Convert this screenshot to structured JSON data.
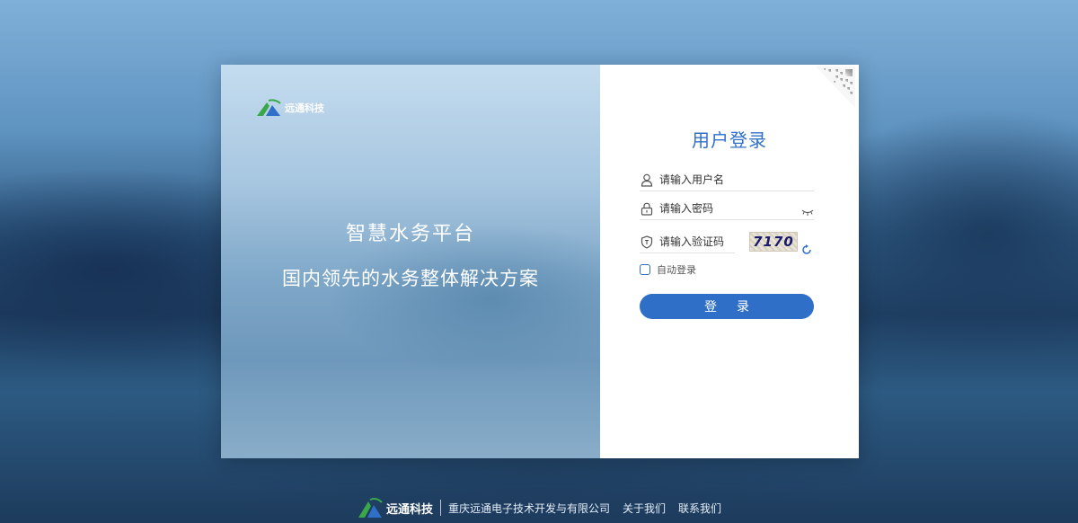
{
  "brand": {
    "name": "远通科技"
  },
  "hero": {
    "title": "智慧水务平台",
    "subtitle": "国内领先的水务整体解决方案"
  },
  "login": {
    "title": "用户登录",
    "username_placeholder": "请输入用户名",
    "password_placeholder": "请输入密码",
    "captcha_placeholder": "请输入验证码",
    "captcha_code": "7170",
    "auto_login_label": "自动登录",
    "submit_label": "登录"
  },
  "footer": {
    "company": "重庆远通电子技术开发与有限公司",
    "about": "关于我们",
    "contact": "联系我们"
  },
  "colors": {
    "accent": "#2f6fc8",
    "logo_green": "#3aa84a",
    "logo_blue": "#2f6fc8"
  },
  "icons": [
    "user-icon",
    "lock-icon",
    "eye-closed-icon",
    "shield-icon",
    "refresh-icon",
    "qr-code-icon"
  ]
}
